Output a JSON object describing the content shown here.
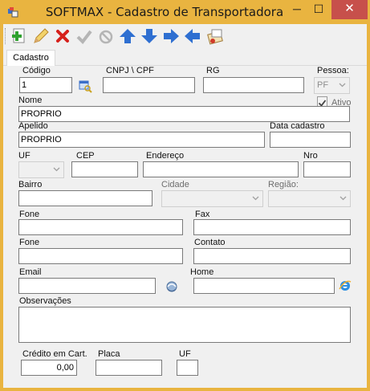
{
  "window": {
    "title": "SOFTMAX - Cadastro de Transportadora",
    "min_glyph": "─",
    "max_glyph": "☐",
    "close_glyph": "✕",
    "frame_color": "#e9b440"
  },
  "toolbar": {
    "buttons": [
      {
        "name": "new",
        "icon": "add-document-icon"
      },
      {
        "name": "edit",
        "icon": "edit-pencil-icon"
      },
      {
        "name": "delete",
        "icon": "delete-x-icon"
      },
      {
        "name": "confirm",
        "icon": "checkmark-icon",
        "disabled": true
      },
      {
        "name": "cancel",
        "icon": "cancel-icon",
        "disabled": true
      },
      {
        "name": "first",
        "icon": "arrow-up-icon"
      },
      {
        "name": "previous",
        "icon": "arrow-down-icon"
      },
      {
        "name": "next",
        "icon": "arrow-right-icon"
      },
      {
        "name": "last",
        "icon": "arrow-left-icon"
      },
      {
        "name": "print",
        "icon": "report-icon"
      }
    ]
  },
  "tabs": [
    {
      "label": "Cadastro",
      "active": true
    }
  ],
  "form": {
    "codigo": {
      "label": "Código",
      "value": "1"
    },
    "cnpj": {
      "label": "CNPJ \\ CPF",
      "value": ""
    },
    "rg": {
      "label": "RG",
      "value": ""
    },
    "pessoa": {
      "label": "Pessoa:",
      "value": "PF"
    },
    "ativo": {
      "label": "Ativo",
      "checked": true
    },
    "nome": {
      "label": "Nome",
      "value": "PROPRIO"
    },
    "apelido": {
      "label": "Apelido",
      "value": "PROPRIO"
    },
    "data_cadastro": {
      "label": "Data cadastro",
      "value": ""
    },
    "uf": {
      "label": "UF",
      "value": ""
    },
    "cep": {
      "label": "CEP",
      "value": ""
    },
    "endereco": {
      "label": "Endereço",
      "value": ""
    },
    "nro": {
      "label": "Nro",
      "value": ""
    },
    "bairro": {
      "label": "Bairro",
      "value": ""
    },
    "cidade": {
      "label": "Cidade",
      "value": ""
    },
    "regiao": {
      "label": "Região:",
      "value": ""
    },
    "fone1": {
      "label": "Fone",
      "value": ""
    },
    "fax": {
      "label": "Fax",
      "value": ""
    },
    "fone2": {
      "label": "Fone",
      "value": ""
    },
    "contato": {
      "label": "Contato",
      "value": ""
    },
    "email": {
      "label": "Email",
      "value": ""
    },
    "home": {
      "label": "Home",
      "value": ""
    },
    "observacoes": {
      "label": "Observações",
      "value": ""
    },
    "credito": {
      "label": "Crédito em Cart.",
      "value": "0,00"
    },
    "placa": {
      "label": "Placa",
      "value": ""
    },
    "uf_placa": {
      "label": "UF",
      "value": ""
    }
  }
}
